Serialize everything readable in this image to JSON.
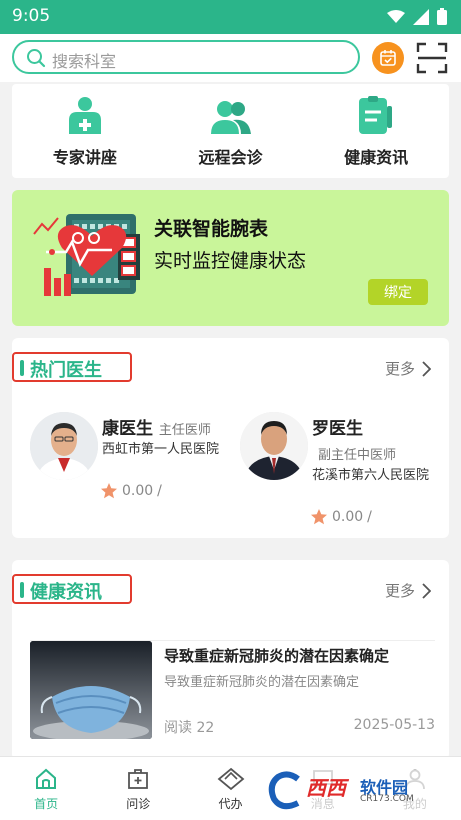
{
  "status_bar": {
    "time": "9:05"
  },
  "search": {
    "placeholder": "搜索科室"
  },
  "quick_menu": [
    {
      "label": "专家讲座",
      "icon": "lecture-icon"
    },
    {
      "label": "远程会诊",
      "icon": "consult-icon"
    },
    {
      "label": "健康资讯",
      "icon": "health-news-icon"
    }
  ],
  "banner": {
    "title": "关联智能腕表",
    "subtitle": "实时监控健康状态",
    "button": "绑定"
  },
  "hot_doctors": {
    "title": "热门医生",
    "more": "更多",
    "items": [
      {
        "name": "康医生",
        "title": "主任医师",
        "hospital": "西虹市第一人民医院",
        "rating": "0.00",
        "suffix": "/"
      },
      {
        "name": "罗医生",
        "title": "副主任中医师",
        "hospital": "花溪市第六人民医院",
        "rating": "0.00",
        "suffix": "/"
      }
    ]
  },
  "health_news": {
    "title": "健康资讯",
    "more": "更多",
    "items": [
      {
        "title": "导致重症新冠肺炎的潜在因素确定",
        "summary": "导致重症新冠肺炎的潜在因素确定",
        "reads": "阅读 22",
        "date": "2025-05-13"
      }
    ]
  },
  "tabbar": [
    {
      "label": "首页",
      "icon": "home-icon",
      "active": true
    },
    {
      "label": "问诊",
      "icon": "clinic-icon",
      "active": false
    },
    {
      "label": "代办",
      "icon": "task-icon",
      "active": false
    },
    {
      "label": "消息",
      "icon": "message-icon",
      "active": false
    },
    {
      "label": "我的",
      "icon": "profile-icon",
      "active": false
    }
  ],
  "watermark": {
    "brand": "西西",
    "name": "软件园",
    "site": "CR173.COM"
  },
  "colors": {
    "accent": "#2bb58a",
    "orange": "#f7921e",
    "banner_bg": "#c9f59a",
    "bind_button": "#b3d428",
    "highlight_border": "#e23b2e"
  }
}
